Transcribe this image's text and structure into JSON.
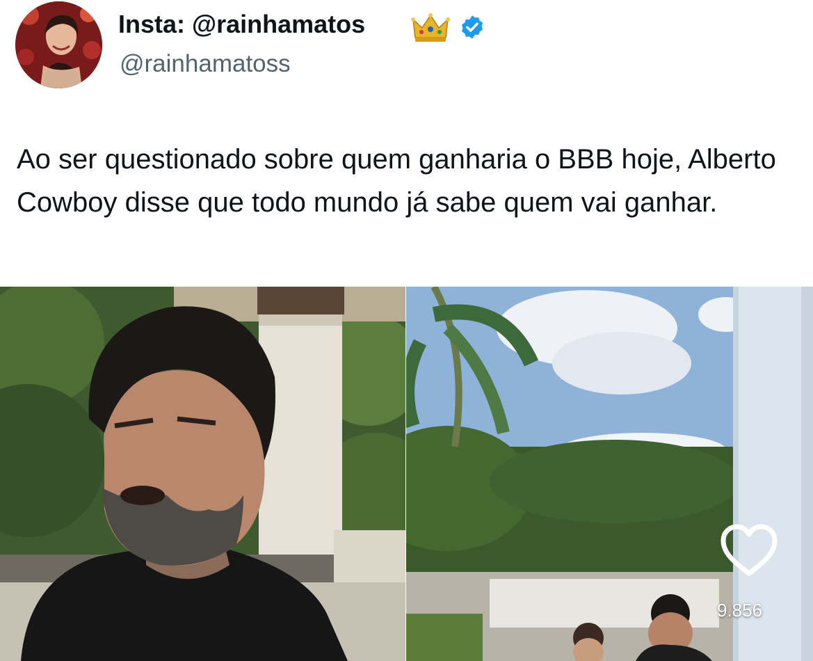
{
  "tweet": {
    "display_name": "Insta: @rainhamatos",
    "handle": "@rainhamatoss",
    "text": "Ao ser questionado sobre quem ganharia o BBB hoje, Alberto Cowboy disse que todo mundo já sabe quem vai ganhar."
  },
  "icons": {
    "crown": "crown-icon",
    "verified": "verified-badge-icon",
    "like": "heart-outline-icon"
  },
  "media": {
    "like_count": "9.856"
  },
  "colors": {
    "text": "#0f1419",
    "secondary": "#536471",
    "verified": "#1d9bf0"
  }
}
